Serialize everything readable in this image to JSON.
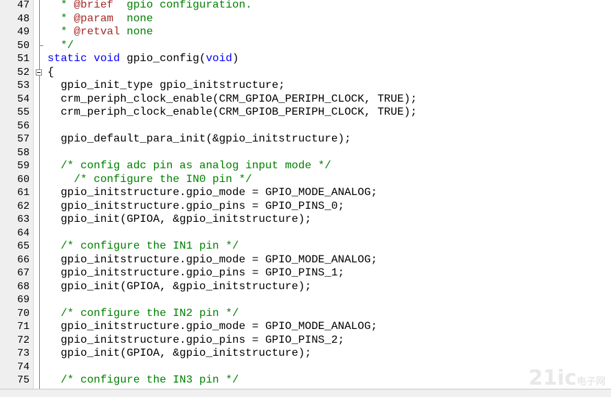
{
  "editor": {
    "lines": [
      {
        "num": "47",
        "segments": [
          {
            "t": "  * ",
            "c": "cm"
          },
          {
            "t": "@brief",
            "c": "dc"
          },
          {
            "t": "  gpio configuration.",
            "c": "cm"
          }
        ]
      },
      {
        "num": "48",
        "segments": [
          {
            "t": "  * ",
            "c": "cm"
          },
          {
            "t": "@param",
            "c": "dc"
          },
          {
            "t": "  none",
            "c": "cm"
          }
        ]
      },
      {
        "num": "49",
        "segments": [
          {
            "t": "  * ",
            "c": "cm"
          },
          {
            "t": "@retval",
            "c": "dc"
          },
          {
            "t": " none",
            "c": "cm"
          }
        ]
      },
      {
        "num": "50",
        "segments": [
          {
            "t": "  */",
            "c": "cm"
          }
        ]
      },
      {
        "num": "51",
        "segments": [
          {
            "t": "static",
            "c": "kw"
          },
          {
            "t": " "
          },
          {
            "t": "void",
            "c": "kw"
          },
          {
            "t": " gpio_config("
          },
          {
            "t": "void",
            "c": "kw"
          },
          {
            "t": ")"
          }
        ]
      },
      {
        "num": "52",
        "segments": [
          {
            "t": "{"
          }
        ]
      },
      {
        "num": "53",
        "segments": [
          {
            "t": "  gpio_init_type gpio_initstructure;"
          }
        ]
      },
      {
        "num": "54",
        "segments": [
          {
            "t": "  crm_periph_clock_enable(CRM_GPIOA_PERIPH_CLOCK, TRUE);"
          }
        ]
      },
      {
        "num": "55",
        "segments": [
          {
            "t": "  crm_periph_clock_enable(CRM_GPIOB_PERIPH_CLOCK, TRUE);"
          }
        ]
      },
      {
        "num": "56",
        "segments": []
      },
      {
        "num": "57",
        "segments": [
          {
            "t": "  gpio_default_para_init(&gpio_initstructure);"
          }
        ]
      },
      {
        "num": "58",
        "segments": []
      },
      {
        "num": "59",
        "segments": [
          {
            "t": "  /* config adc pin as analog input mode */",
            "c": "cm"
          }
        ]
      },
      {
        "num": "60",
        "segments": [
          {
            "t": "    /* configure the IN0 pin */",
            "c": "cm"
          }
        ]
      },
      {
        "num": "61",
        "segments": [
          {
            "t": "  gpio_initstructure.gpio_mode = GPIO_MODE_ANALOG;"
          }
        ]
      },
      {
        "num": "62",
        "segments": [
          {
            "t": "  gpio_initstructure.gpio_pins = GPIO_PINS_0;"
          }
        ]
      },
      {
        "num": "63",
        "segments": [
          {
            "t": "  gpio_init(GPIOA, &gpio_initstructure);"
          }
        ]
      },
      {
        "num": "64",
        "segments": []
      },
      {
        "num": "65",
        "segments": [
          {
            "t": "  /* configure the IN1 pin */",
            "c": "cm"
          }
        ]
      },
      {
        "num": "66",
        "segments": [
          {
            "t": "  gpio_initstructure.gpio_mode = GPIO_MODE_ANALOG;"
          }
        ]
      },
      {
        "num": "67",
        "segments": [
          {
            "t": "  gpio_initstructure.gpio_pins = GPIO_PINS_1;"
          }
        ]
      },
      {
        "num": "68",
        "segments": [
          {
            "t": "  gpio_init(GPIOA, &gpio_initstructure);"
          }
        ]
      },
      {
        "num": "69",
        "segments": []
      },
      {
        "num": "70",
        "segments": [
          {
            "t": "  /* configure the IN2 pin */",
            "c": "cm"
          }
        ]
      },
      {
        "num": "71",
        "segments": [
          {
            "t": "  gpio_initstructure.gpio_mode = GPIO_MODE_ANALOG;"
          }
        ]
      },
      {
        "num": "72",
        "segments": [
          {
            "t": "  gpio_initstructure.gpio_pins = GPIO_PINS_2;"
          }
        ]
      },
      {
        "num": "73",
        "segments": [
          {
            "t": "  gpio_init(GPIOA, &gpio_initstructure);"
          }
        ]
      },
      {
        "num": "74",
        "segments": []
      },
      {
        "num": "75",
        "segments": [
          {
            "t": "  /* configure the IN3 pin */",
            "c": "cm"
          }
        ]
      }
    ],
    "fold": {
      "start_line": "52",
      "collapse_icon": "fold-collapse-icon"
    }
  },
  "colors": {
    "keyword": "#0000ff",
    "comment": "#008000",
    "doc_tag": "#a52a2a",
    "text": "#000000",
    "gutter_bg": "#efefef"
  },
  "watermark": {
    "text": "21ic",
    "cn": "电子网"
  }
}
